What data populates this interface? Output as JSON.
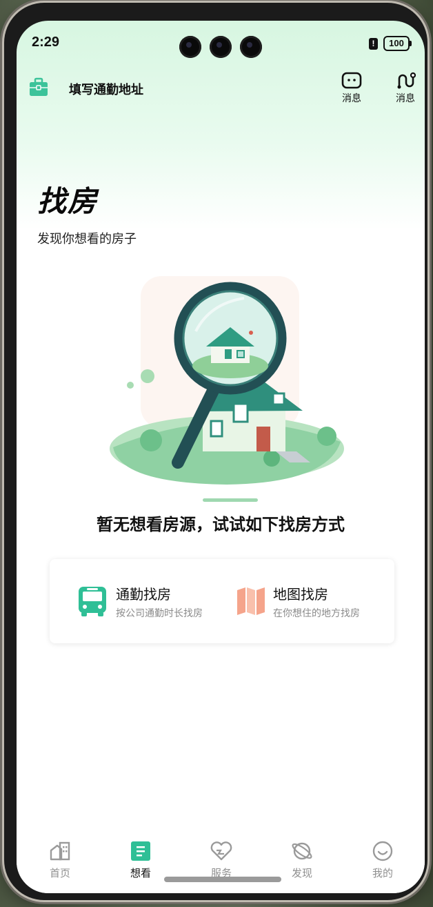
{
  "status_bar": {
    "time": "2:29",
    "battery_level": "100",
    "alert_icon": "!"
  },
  "header": {
    "commute_label": "填写通勤地址",
    "message_button_1": "消息",
    "message_button_2": "消息"
  },
  "page": {
    "title": "找房",
    "subtitle": "发现你想看的房子"
  },
  "empty_state": {
    "title": "暂无想看房源，试试如下找房方式"
  },
  "options": [
    {
      "title": "通勤找房",
      "desc": "按公司通勤时长找房",
      "icon": "bus-icon",
      "color": "#2fbf96"
    },
    {
      "title": "地图找房",
      "desc": "在你想住的地方找房",
      "icon": "map-icon",
      "color": "#f5a48b"
    }
  ],
  "tabs": [
    {
      "label": "首页",
      "icon": "home-icon",
      "active": false
    },
    {
      "label": "想看",
      "icon": "wishlist-icon",
      "active": true
    },
    {
      "label": "服务",
      "icon": "service-icon",
      "active": false
    },
    {
      "label": "发现",
      "icon": "discover-icon",
      "active": false
    },
    {
      "label": "我的",
      "icon": "profile-icon",
      "active": false
    }
  ],
  "colors": {
    "accent": "#2fbf96",
    "map_accent": "#f5a48b",
    "header_tint": "#d7f6e1"
  }
}
